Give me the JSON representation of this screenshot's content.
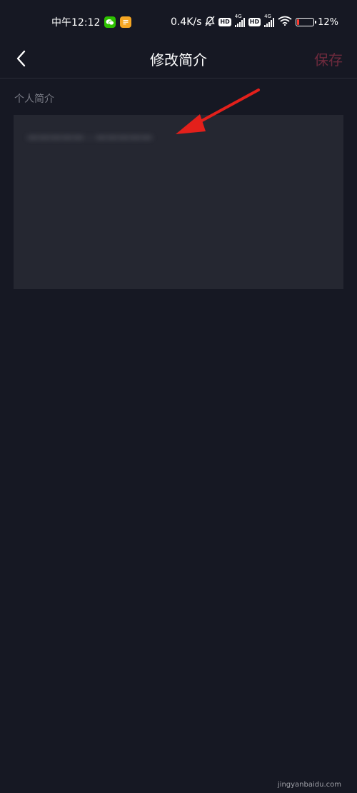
{
  "status_bar": {
    "time": "中午12:12",
    "net_speed": "0.4K/s",
    "hd1": "HD",
    "hd2": "HD",
    "net1": "4G",
    "net2": "4G",
    "battery_level": 0.12,
    "battery_percent": "12%",
    "icons": [
      "wechat-icon",
      "notes-app-icon",
      "mute-bell-icon",
      "wifi-icon",
      "battery-icon"
    ]
  },
  "nav": {
    "title": "修改简介",
    "save_label": "保存",
    "back_icon": "chevron-left-icon"
  },
  "bio": {
    "section_label": "个人简介",
    "text": "一一一一一 · 一一一一一"
  },
  "watermark": "jingyanbaidu.com",
  "colors": {
    "background": "#161823",
    "field_background": "#252731",
    "save_disabled": "#6e2a3d",
    "annotation_arrow": "#e3201b"
  }
}
